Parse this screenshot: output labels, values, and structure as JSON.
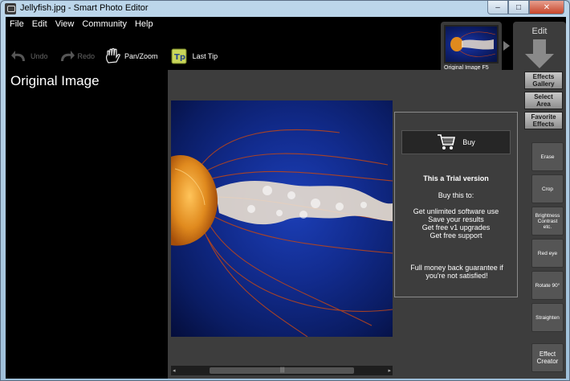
{
  "window": {
    "title": "Jellyfish.jpg - Smart Photo Editor",
    "controls": {
      "minimize": "–",
      "maximize": "□",
      "close": "✕"
    }
  },
  "menu": [
    "File",
    "Edit",
    "View",
    "Community",
    "Help"
  ],
  "toolbar": {
    "undo": "Undo",
    "redo": "Redo",
    "pan_zoom": "Pan/Zoom",
    "last_tip": "Last Tip"
  },
  "left_panel": {
    "title": "Original Image"
  },
  "thumbnail": {
    "caption": "Original Image F5"
  },
  "edit_tab": {
    "label": "Edit"
  },
  "trial": {
    "buy_label": "Buy",
    "heading": "This a Trial version",
    "subheading": "Buy this to:",
    "benefits": [
      "Get unlimited software use",
      "Save your results",
      "Get free v1 upgrades",
      "Get free support"
    ],
    "guarantee_line1": "Full money back guarantee if",
    "guarantee_line2": "you're not satisfied!"
  },
  "scrollbar": {
    "grip": "|||",
    "left": "◂",
    "right": "▸"
  },
  "side_menu": {
    "effects_gallery": [
      "Effects",
      "Gallery"
    ],
    "select_area": [
      "Select",
      "Area"
    ],
    "favorite_effects": [
      "Favorite",
      "Effects"
    ]
  },
  "tools": {
    "erase": "Erase",
    "crop": "Crop",
    "brightness": [
      "Brightness",
      "Contrast",
      "etc."
    ],
    "red_eye": "Red eye",
    "rotate": "Rotate 90°",
    "straighten": "Straighten",
    "effect_creator": [
      "Effect",
      "Creator"
    ]
  },
  "colors": {
    "background": "#000000",
    "panel": "#3d3d3d",
    "image_blue": "#122c8f",
    "jellyfish_orange": "#e08a1e"
  }
}
